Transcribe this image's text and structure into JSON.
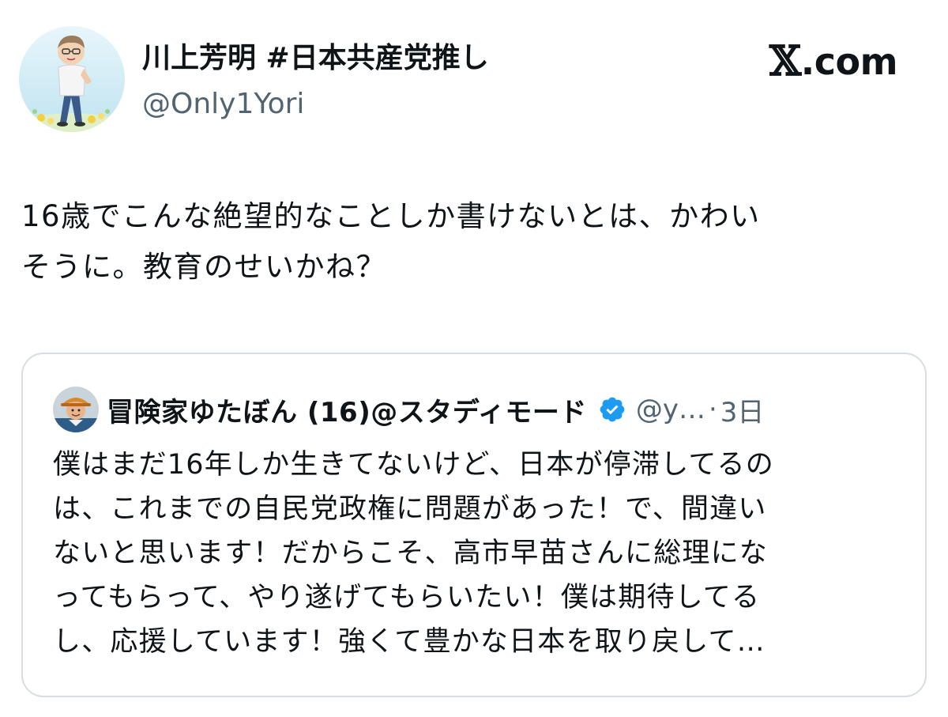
{
  "author": {
    "display_name": "川上芳明 #日本共産党推し",
    "handle": "@Only1Yori",
    "avatar_icon": "cartoon-man-avatar"
  },
  "brand": {
    "label": ".com",
    "logo_icon": "x-logo-icon"
  },
  "tweet": {
    "text": "16歳でこんな絶望的なことしか書けないとは、かわい\nそうに。教育のせいかね？"
  },
  "quoted_tweet": {
    "display_name": "冒険家ゆたぼん (16)@スタディモード",
    "verified": true,
    "verified_color": "#1d9bf0",
    "handle": "@y…",
    "separator": "·",
    "timestamp": "3日",
    "avatar_icon": "man-with-hat-avatar",
    "text": "僕はまだ16年しか生きてないけど、日本が停滞してるの\nは、これまでの自民党政権に問題があった！で、間違い\nないと思います！だからこそ、高市早苗さんに総理にな\nってもらって、やり遂げてもらいたい！僕は期待してる\nし、応援しています！強くて豊かな日本を取り戻して…"
  },
  "colors": {
    "text_primary": "#0f1419",
    "text_secondary": "#536471",
    "border": "#d8dde2",
    "verified_blue": "#1d9bf0"
  }
}
